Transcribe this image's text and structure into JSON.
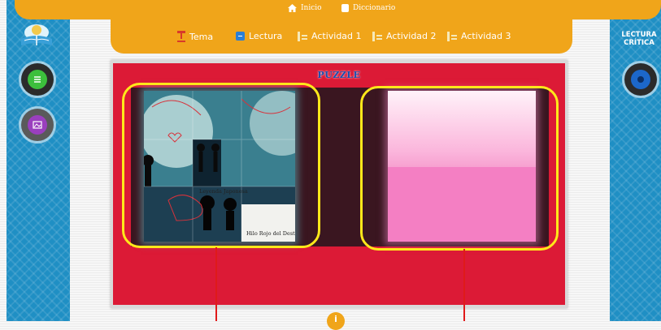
{
  "topnav": {
    "home_label": "Inicio",
    "dictionary_label": "Diccionario"
  },
  "subnav": {
    "items": [
      {
        "label": "Tema",
        "icon": "pencil-icon"
      },
      {
        "label": "Lectura",
        "icon": "reading-icon"
      },
      {
        "label": "Actividad 1",
        "icon": "activity-icon"
      },
      {
        "label": "Actividad 2",
        "icon": "activity-icon"
      },
      {
        "label": "Actividad 3",
        "icon": "activity-icon"
      }
    ]
  },
  "sidebar_right": {
    "title_line1": "LECTURA",
    "title_line2": "CRÍTICA"
  },
  "puzzle": {
    "title": "PUZZLE",
    "image_caption_top": "Leyenda Japonesa",
    "image_caption_bottom": "Hilo Rojo del Destino"
  },
  "colors": {
    "accent_orange": "#f0a51a",
    "side_blue": "#1f8fc4",
    "panel_red": "#dc1a36",
    "highlight_yellow": "#ffe81a"
  }
}
